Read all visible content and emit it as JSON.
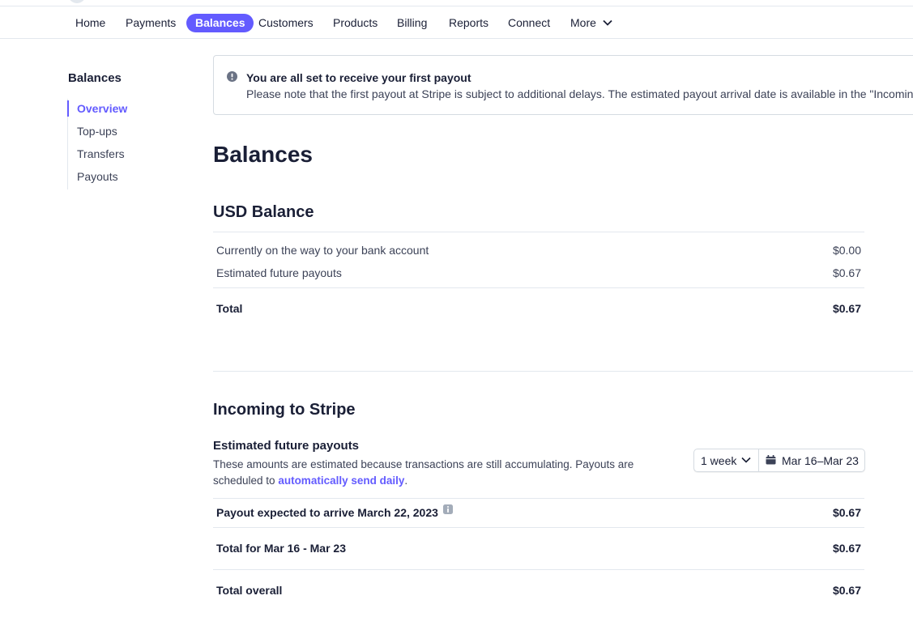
{
  "nav": {
    "items": [
      {
        "label": "Home",
        "active": false
      },
      {
        "label": "Payments",
        "active": false
      },
      {
        "label": "Balances",
        "active": true
      },
      {
        "label": "Customers",
        "active": false
      },
      {
        "label": "Products",
        "active": false
      },
      {
        "label": "Billing",
        "active": false
      },
      {
        "label": "Reports",
        "active": false
      },
      {
        "label": "Connect",
        "active": false
      },
      {
        "label": "More",
        "active": false
      }
    ],
    "accent_color": "#635bff"
  },
  "sidebar": {
    "title": "Balances",
    "items": [
      {
        "label": "Overview",
        "active": true
      },
      {
        "label": "Top-ups",
        "active": false
      },
      {
        "label": "Transfers",
        "active": false
      },
      {
        "label": "Payouts",
        "active": false
      }
    ]
  },
  "alert": {
    "icon": "exclamation-circle-icon",
    "title": "You are all set to receive your first payout",
    "body": "Please note that the first payout at Stripe is subject to additional delays. The estimated payout arrival date is available in the \"Incoming"
  },
  "page_title": "Balances",
  "usd_balance": {
    "title": "USD Balance",
    "rows": [
      {
        "label": "Currently on the way to your bank account",
        "value": "$0.00"
      },
      {
        "label": "Estimated future payouts",
        "value": "$0.67"
      }
    ],
    "total": {
      "label": "Total",
      "value": "$0.67"
    }
  },
  "incoming": {
    "title": "Incoming to Stripe",
    "subtitle": "Estimated future payouts",
    "description_prefix": "These amounts are estimated because transactions are still accumulating. Payouts are scheduled to ",
    "description_link": "automatically send daily",
    "description_suffix": ".",
    "period_select": "1 week",
    "date_range": "Mar 16–Mar 23",
    "payout_row": {
      "label": "Payout expected to arrive March 22, 2023",
      "value": "$0.67"
    },
    "total_range": {
      "label": "Total for Mar 16 - Mar 23",
      "value": "$0.67"
    },
    "total_overall": {
      "label": "Total overall",
      "value": "$0.67"
    }
  }
}
